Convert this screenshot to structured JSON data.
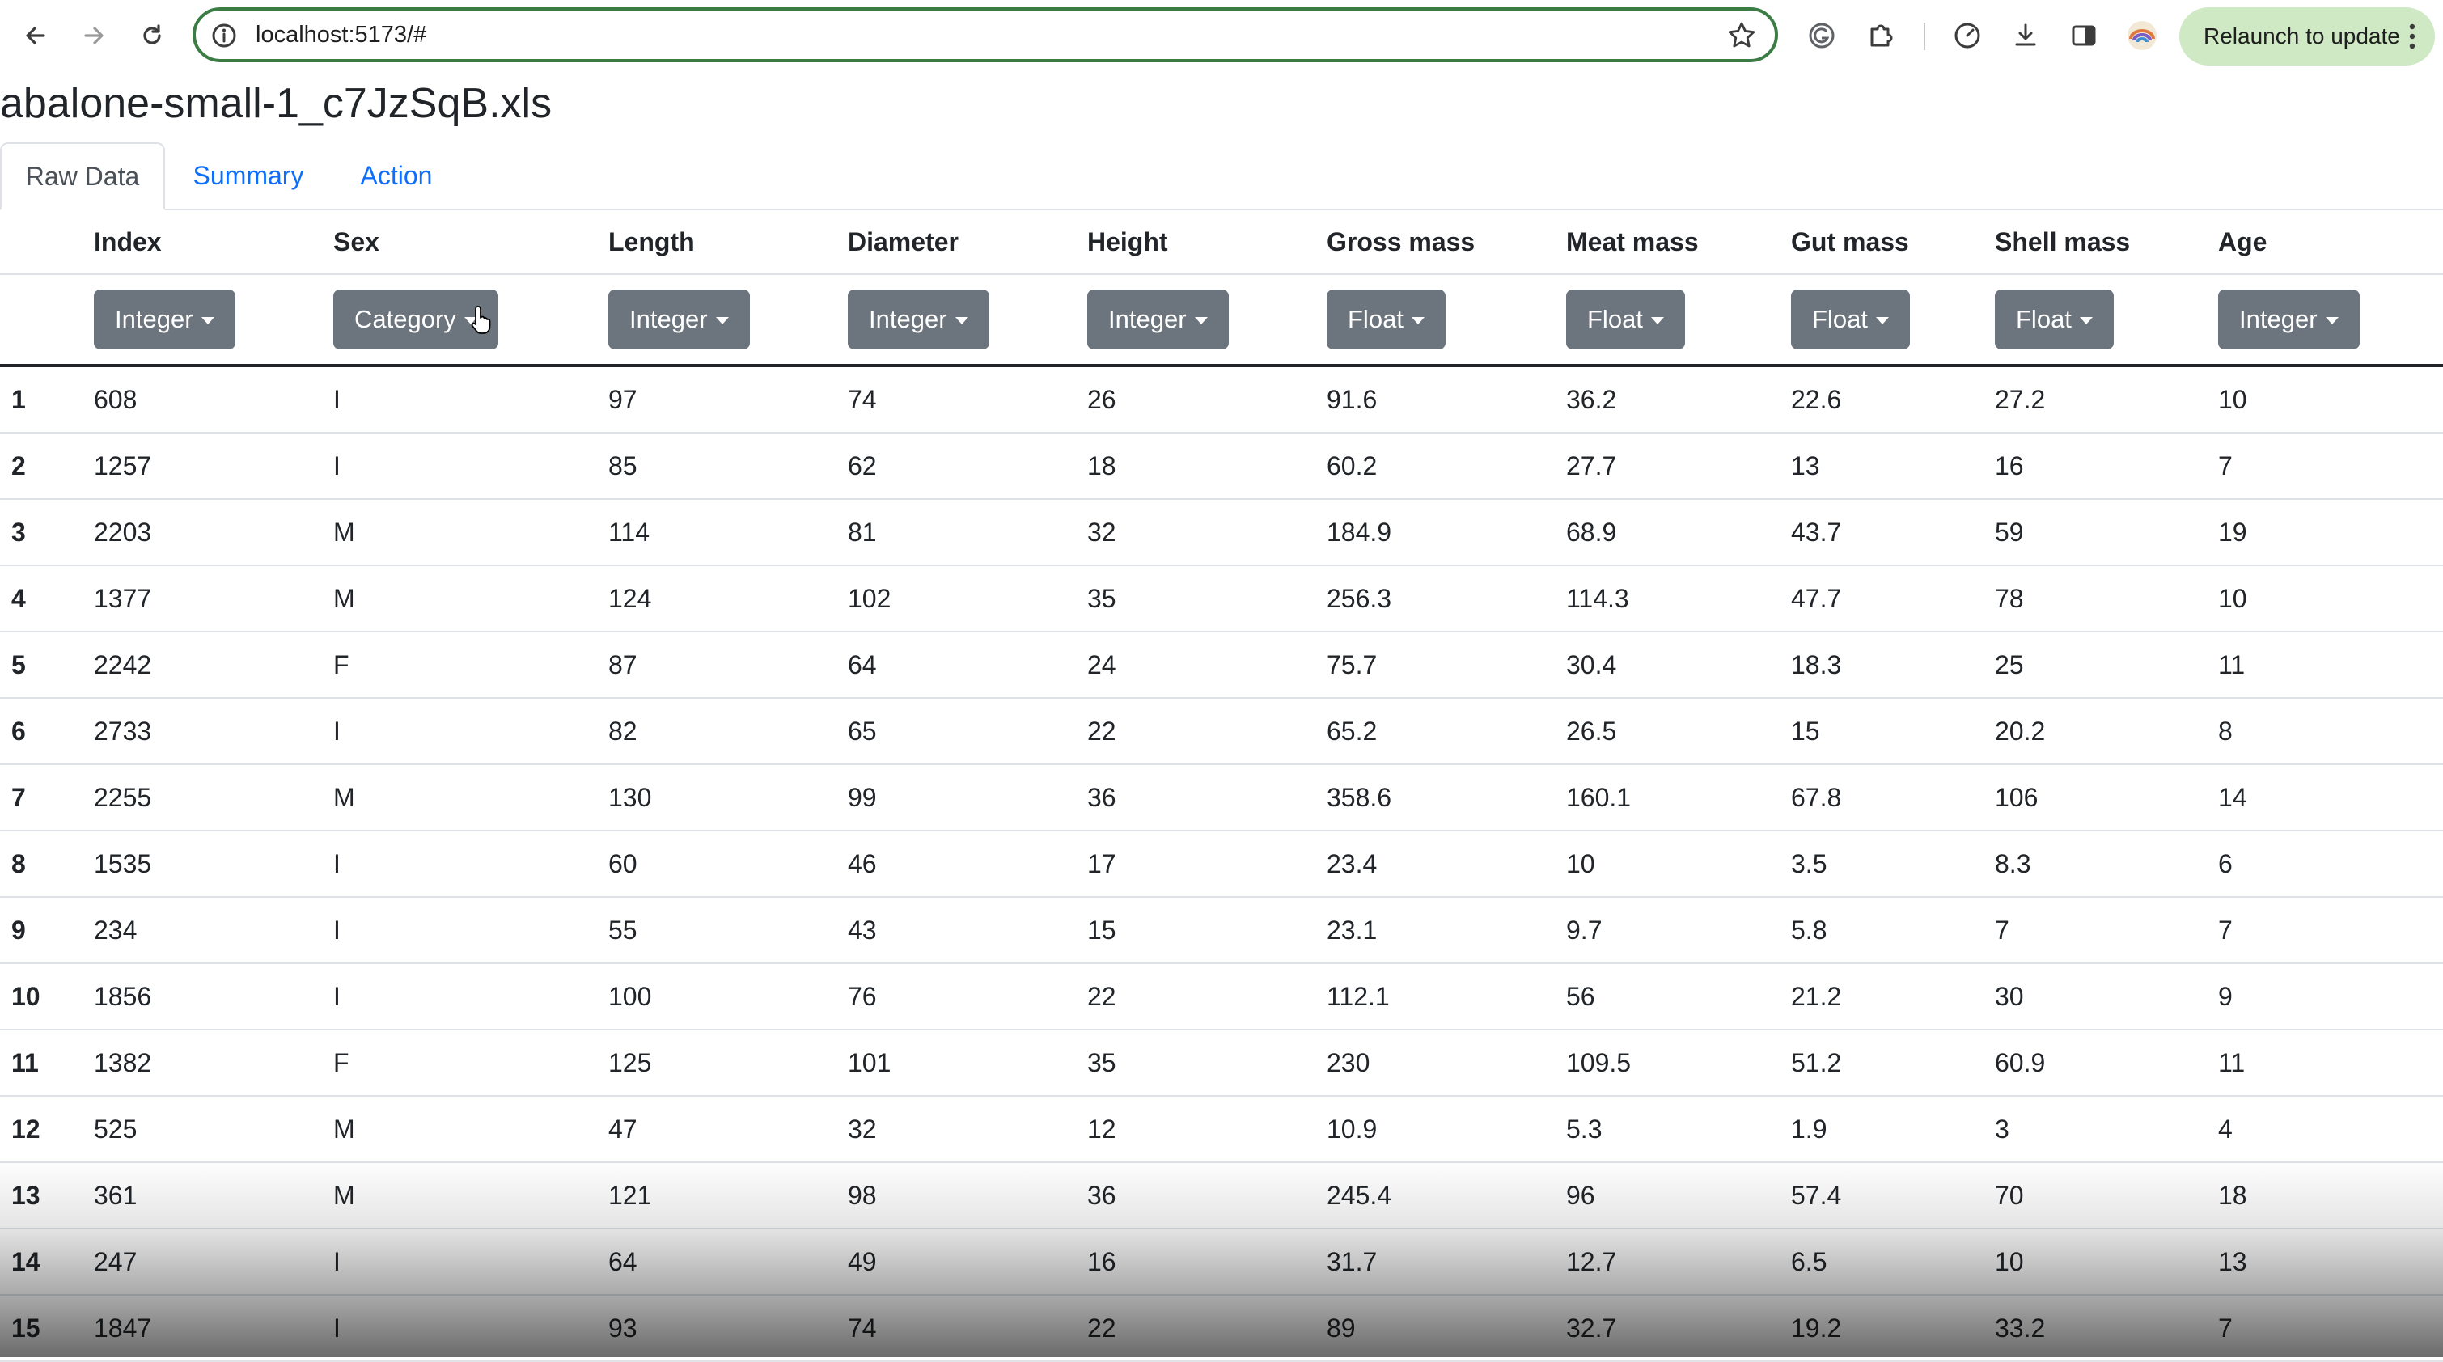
{
  "browser": {
    "url": "localhost:5173/#",
    "relaunch_label": "Relaunch to update"
  },
  "page": {
    "title": "abalone-small-1_c7JzSqB.xls"
  },
  "tabs": [
    {
      "label": "Raw Data",
      "active": true
    },
    {
      "label": "Summary",
      "active": false
    },
    {
      "label": "Action",
      "active": false
    }
  ],
  "table": {
    "columns": [
      {
        "name": "Index",
        "type": "Integer"
      },
      {
        "name": "Sex",
        "type": "Category"
      },
      {
        "name": "Length",
        "type": "Integer"
      },
      {
        "name": "Diameter",
        "type": "Integer"
      },
      {
        "name": "Height",
        "type": "Integer"
      },
      {
        "name": "Gross mass",
        "type": "Float"
      },
      {
        "name": "Meat mass",
        "type": "Float"
      },
      {
        "name": "Gut mass",
        "type": "Float"
      },
      {
        "name": "Shell mass",
        "type": "Float"
      },
      {
        "name": "Age",
        "type": "Integer"
      }
    ],
    "rows": [
      [
        "1",
        "608",
        "I",
        "97",
        "74",
        "26",
        "91.6",
        "36.2",
        "22.6",
        "27.2",
        "10"
      ],
      [
        "2",
        "1257",
        "I",
        "85",
        "62",
        "18",
        "60.2",
        "27.7",
        "13",
        "16",
        "7"
      ],
      [
        "3",
        "2203",
        "M",
        "114",
        "81",
        "32",
        "184.9",
        "68.9",
        "43.7",
        "59",
        "19"
      ],
      [
        "4",
        "1377",
        "M",
        "124",
        "102",
        "35",
        "256.3",
        "114.3",
        "47.7",
        "78",
        "10"
      ],
      [
        "5",
        "2242",
        "F",
        "87",
        "64",
        "24",
        "75.7",
        "30.4",
        "18.3",
        "25",
        "11"
      ],
      [
        "6",
        "2733",
        "I",
        "82",
        "65",
        "22",
        "65.2",
        "26.5",
        "15",
        "20.2",
        "8"
      ],
      [
        "7",
        "2255",
        "M",
        "130",
        "99",
        "36",
        "358.6",
        "160.1",
        "67.8",
        "106",
        "14"
      ],
      [
        "8",
        "1535",
        "I",
        "60",
        "46",
        "17",
        "23.4",
        "10",
        "3.5",
        "8.3",
        "6"
      ],
      [
        "9",
        "234",
        "I",
        "55",
        "43",
        "15",
        "23.1",
        "9.7",
        "5.8",
        "7",
        "7"
      ],
      [
        "10",
        "1856",
        "I",
        "100",
        "76",
        "22",
        "112.1",
        "56",
        "21.2",
        "30",
        "9"
      ],
      [
        "11",
        "1382",
        "F",
        "125",
        "101",
        "35",
        "230",
        "109.5",
        "51.2",
        "60.9",
        "11"
      ],
      [
        "12",
        "525",
        "M",
        "47",
        "32",
        "12",
        "10.9",
        "5.3",
        "1.9",
        "3",
        "4"
      ],
      [
        "13",
        "361",
        "M",
        "121",
        "98",
        "36",
        "245.4",
        "96",
        "57.4",
        "70",
        "18"
      ],
      [
        "14",
        "247",
        "I",
        "64",
        "49",
        "16",
        "31.7",
        "12.7",
        "6.5",
        "10",
        "13"
      ],
      [
        "15",
        "1847",
        "I",
        "93",
        "74",
        "22",
        "89",
        "32.7",
        "19.2",
        "33.2",
        "7"
      ]
    ]
  }
}
